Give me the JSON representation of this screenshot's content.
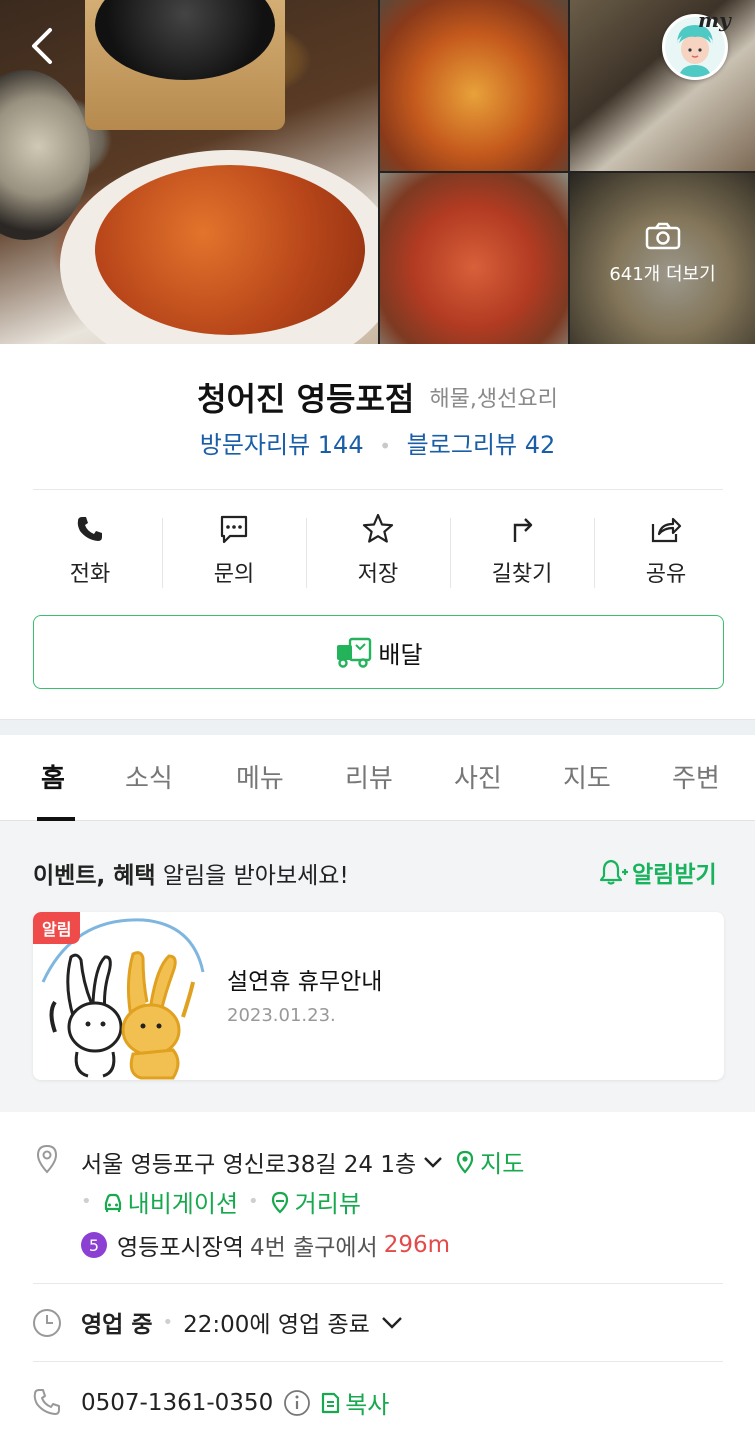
{
  "gallery": {
    "more_label": "641개 더보기",
    "my_label": "my"
  },
  "place": {
    "name": "청어진 영등포점",
    "category": "해물,생선요리",
    "visitor_reviews": "방문자리뷰 144",
    "blog_reviews": "블로그리뷰 42"
  },
  "actions": [
    {
      "label": "전화",
      "icon": "phone-icon"
    },
    {
      "label": "문의",
      "icon": "chat-icon"
    },
    {
      "label": "저장",
      "icon": "star-icon"
    },
    {
      "label": "길찾기",
      "icon": "directions-icon"
    },
    {
      "label": "공유",
      "icon": "share-icon"
    }
  ],
  "delivery": {
    "label": "배달",
    "icon": "delivery-truck-icon"
  },
  "tabs": [
    "홈",
    "소식",
    "메뉴",
    "리뷰",
    "사진",
    "지도",
    "주변"
  ],
  "notice": {
    "header_bold": "이벤트, 혜택",
    "header_rest": " 알림을 받아보세요!",
    "notify_label": "알림받기",
    "badge": "알림",
    "title": "설연휴 휴무안내",
    "date": "2023.01.23."
  },
  "info": {
    "address": "서울 영등포구 영신로38길 24 1층",
    "map_link": "지도",
    "navigation_link": "내비게이션",
    "streetview_link": "거리뷰",
    "subway_line": "5",
    "subway_station": "영등포시장역",
    "subway_exit": "4번 출구에서",
    "subway_distance": "296m",
    "status": "영업 중",
    "hours": "22:00에 영업 종료",
    "phone": "0507-1361-0350",
    "copy_label": "복사"
  },
  "colors": {
    "accent_green": "#18a94f",
    "review_blue": "#1a5ea8",
    "badge_red": "#f04b4b",
    "subway_line5": "#8b3fd3",
    "distance_red": "#e34a4a"
  }
}
